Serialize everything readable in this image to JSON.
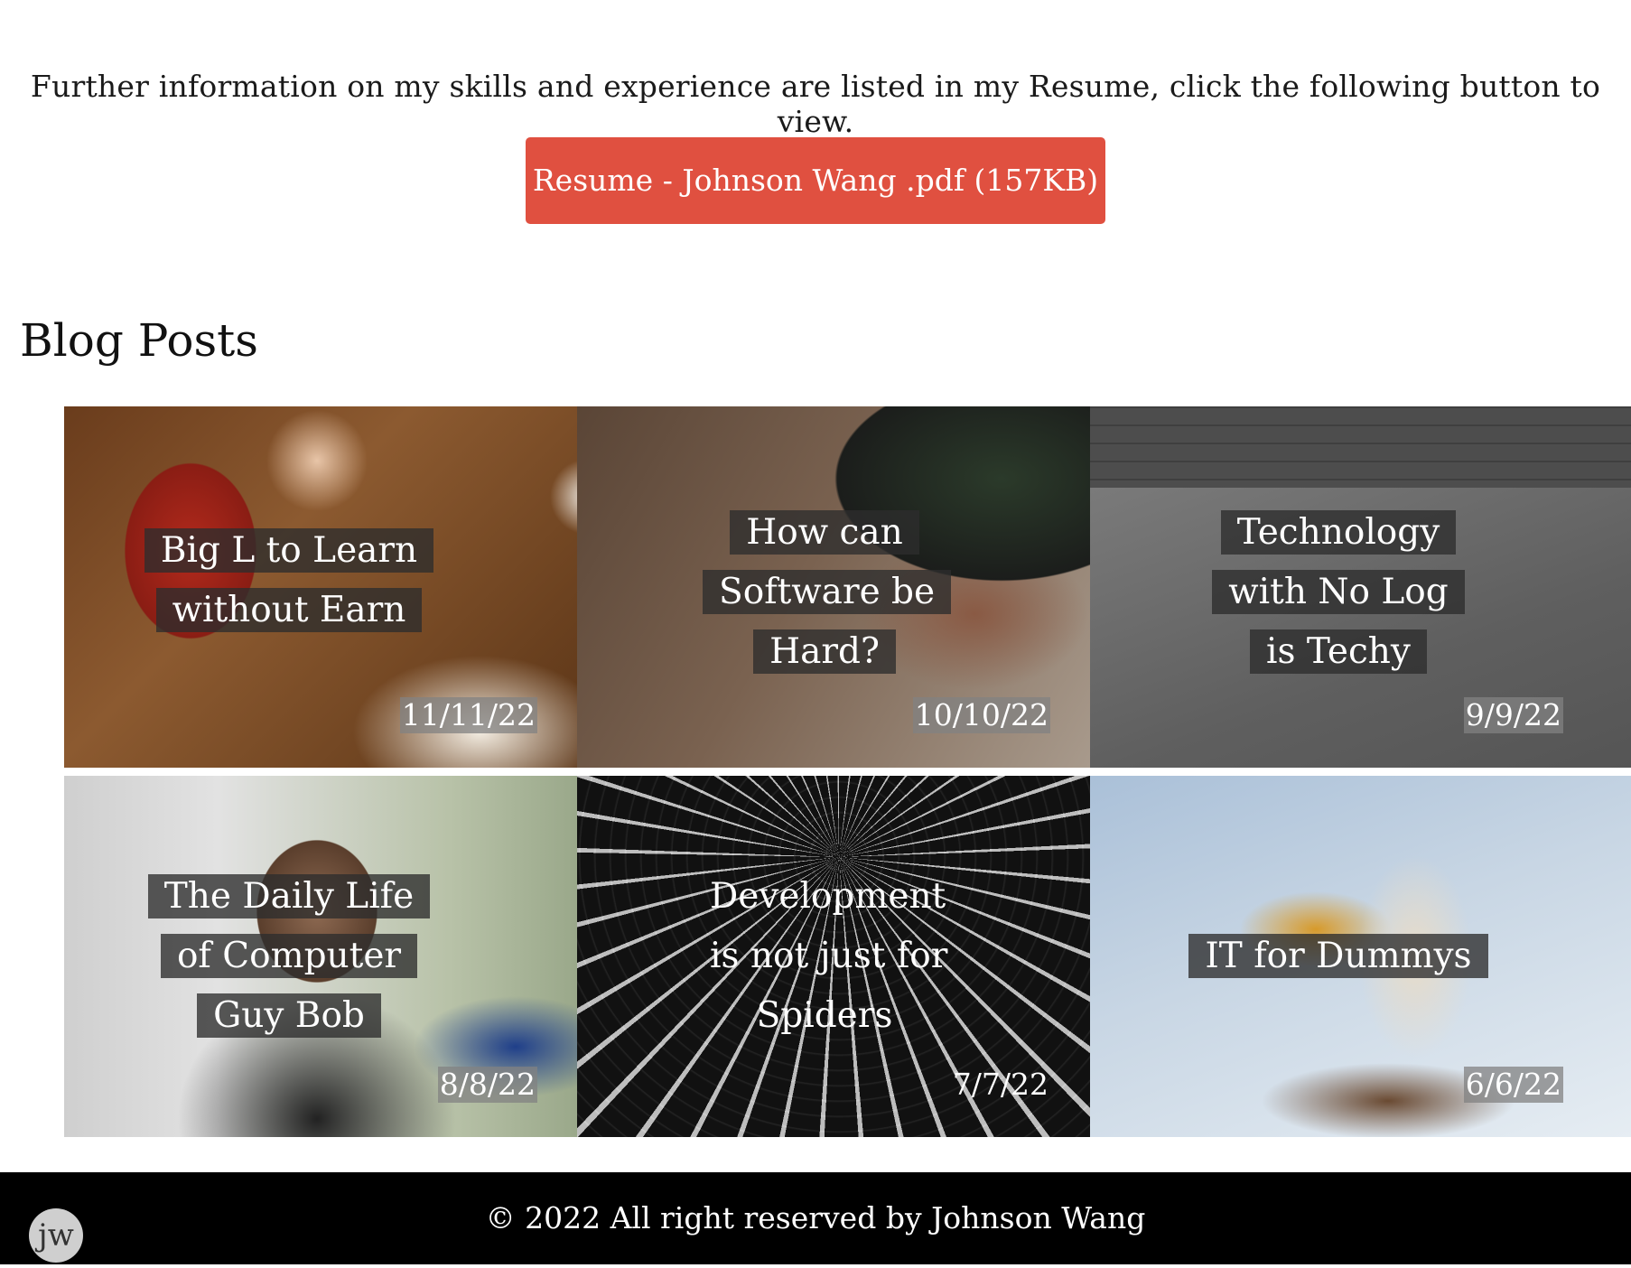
{
  "intro": {
    "text": "Further information on my skills and experience are listed in my Resume, click the following button to view."
  },
  "resume_button": {
    "label": "Resume - Johnson Wang .pdf (157KB)",
    "color": "#e05040"
  },
  "blog": {
    "heading": "Blog Posts",
    "posts": [
      {
        "title": "Big L to Learn without Earn",
        "date": "11/11/22"
      },
      {
        "title": "How can Software be Hard?",
        "date": "10/10/22"
      },
      {
        "title": "Technology with No Log is Techy",
        "date": "9/9/22"
      },
      {
        "title": "The Daily Life of Computer Guy Bob",
        "date": "8/8/22"
      },
      {
        "title": "Development is not just for Spiders",
        "date": "7/7/22"
      },
      {
        "title": "IT for Dummys",
        "date": "6/6/22"
      }
    ]
  },
  "footer": {
    "text": "© 2022 All right reserved by Johnson Wang",
    "logo_text": "jw"
  }
}
